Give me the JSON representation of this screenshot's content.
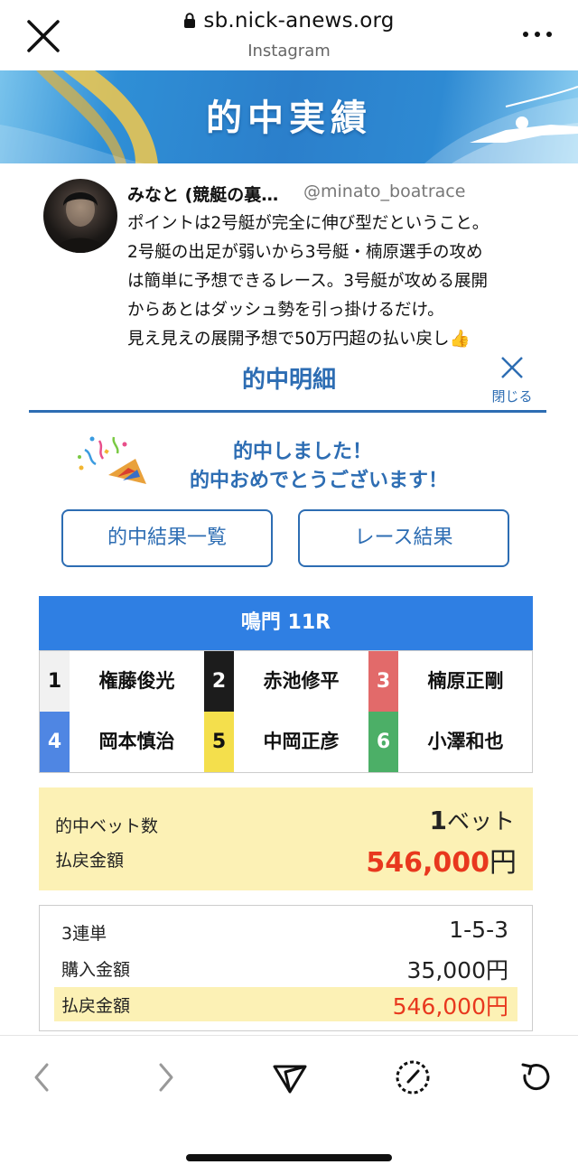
{
  "browser": {
    "url": "sb.nick-anews.org",
    "subtitle": "Instagram"
  },
  "banner": {
    "title": "的中実績"
  },
  "tweet": {
    "name": "みなと (競艇の裏…",
    "handle": "@minato_boatrace",
    "lines": [
      "ポイントは2号艇が完全に伸び型だということ。",
      "2号艇の出足が弱いから3号艇・楠原選手の攻め",
      "は簡単に予想できるレース。3号艇が攻める展開",
      "からあとはダッシュ勢を引っ掛けるだけ。",
      "見え見えの展開予想で50万円超の払い戻し👍"
    ]
  },
  "panel": {
    "title": "的中明細",
    "close_label": "閉じる",
    "message_line1": "的中しました！",
    "message_line2": "的中おめでとうございます！",
    "btn_results_list": "的中結果一覧",
    "btn_race_results": "レース結果",
    "race_header": "鳴門 11R",
    "racers": [
      {
        "num": "1",
        "name": "権藤俊光",
        "color": "#f1f1f1",
        "text_color": "#111111"
      },
      {
        "num": "2",
        "name": "赤池修平",
        "color": "#1c1c1c",
        "text_color": "#ffffff"
      },
      {
        "num": "3",
        "name": "楠原正剛",
        "color": "#e26a6a",
        "text_color": "#ffffff"
      },
      {
        "num": "4",
        "name": "岡本慎治",
        "color": "#4f86e3",
        "text_color": "#ffffff"
      },
      {
        "num": "5",
        "name": "中岡正彦",
        "color": "#f4df4c",
        "text_color": "#111111"
      },
      {
        "num": "6",
        "name": "小澤和也",
        "color": "#4caf67",
        "text_color": "#ffffff"
      }
    ],
    "summary": {
      "bets_label": "的中ベット数",
      "bets_count": "1",
      "bets_unit": "ベット",
      "payout_label": "払戻金額",
      "payout_amount": "546,000",
      "payout_unit": "円"
    },
    "ticket": {
      "type_label": "3連単",
      "combination": "1-5-3",
      "purchase_label": "購入金額",
      "purchase_amount": "35,000円",
      "payout_label": "払戻金額",
      "payout_amount": "546,000円"
    }
  },
  "colors": {
    "accent_blue": "#2d6db3",
    "race_header_blue": "#2f7fe3",
    "payout_red": "#e8381e",
    "highlight_yellow": "#fcf1b5"
  },
  "icons": {
    "close": "close-x-icon",
    "lock": "lock-icon",
    "more": "more-dots-icon",
    "party": "party-popper-icon",
    "back": "chevron-left-icon",
    "forward": "chevron-right-icon",
    "share": "send-icon",
    "compass": "compass-icon",
    "reload": "reload-icon"
  }
}
